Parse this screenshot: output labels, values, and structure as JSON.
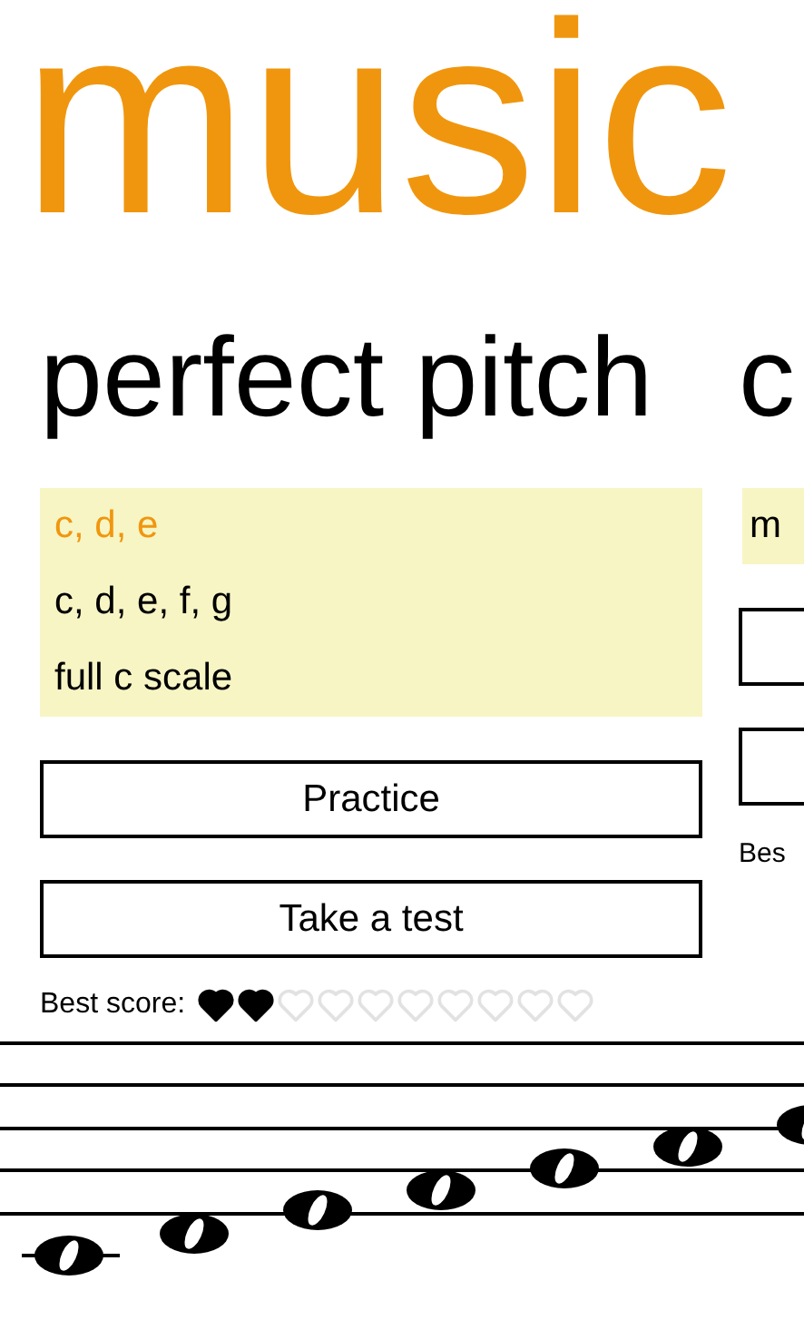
{
  "title": "music",
  "sections": [
    {
      "header": "perfect pitch",
      "levels": [
        {
          "label": "c, d, e",
          "selected": true
        },
        {
          "label": "c, d, e, f, g",
          "selected": false
        },
        {
          "label": "full c scale",
          "selected": false
        }
      ],
      "buttons": [
        {
          "kind": "labeled",
          "label": "Practice"
        },
        {
          "kind": "labeled",
          "label": "Take a test"
        }
      ],
      "best_score_label": "Best score:",
      "stars": 2
    },
    {
      "header": "c",
      "levels": [
        {
          "label": "m",
          "selected": false
        }
      ],
      "buttons": [
        {
          "kind": "clipped"
        },
        {
          "kind": "clipped"
        }
      ],
      "best_score_label": "Bes"
    }
  ]
}
